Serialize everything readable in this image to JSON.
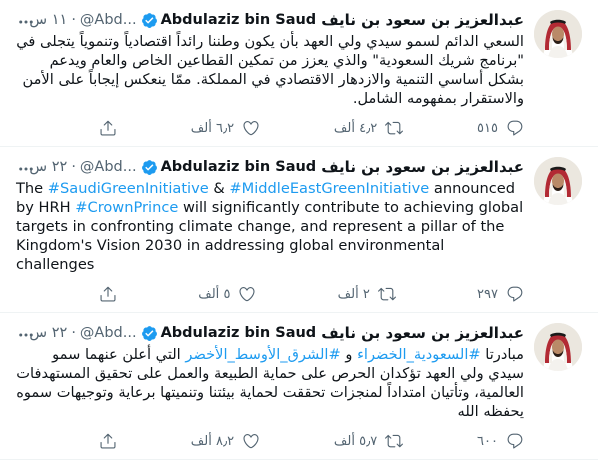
{
  "tweets": [
    {
      "name_ar": "عبدالعزيز بن سعود بن نايف",
      "name_en": "Abdulaziz bin Saud",
      "handle": "@Abd...",
      "time": "١١ س",
      "segments": [
        {
          "text": "السعي الدائم لسمو سيدي ولي العهد بأن يكون وطننا رائداً اقتصادياً وتنموياً يتجلى في \"برنامج شريك السعودية\" والذي يعزز من تمكين القطاعين الخاص والعام ويدعم بشكل أساسي التنمية والازدهار الاقتصادي في المملكة. ممّا ينعكس إيجاباً على الأمن والاستقرار بمفهومه الشامل.",
          "tag": false
        }
      ],
      "dir": "rtl",
      "replies": "٥١٥",
      "retweets": "٤٫٢ ألف",
      "likes": "٦٫٢ ألف"
    },
    {
      "name_ar": "عبدالعزيز بن سعود بن نايف",
      "name_en": "Abdulaziz bin Saud",
      "handle": "@Abd...",
      "time": "٢٢ س",
      "segments": [
        {
          "text": "The ",
          "tag": false
        },
        {
          "text": "#SaudiGreenInitiative",
          "tag": true
        },
        {
          "text": " & ",
          "tag": false
        },
        {
          "text": "#MiddleEastGreenInitiative",
          "tag": true
        },
        {
          "text": " announced by HRH ",
          "tag": false
        },
        {
          "text": "#CrownPrince",
          "tag": true
        },
        {
          "text": " will significantly contribute to achieving global targets in confronting climate change, and represent a pillar of the Kingdom's Vision 2030 in addressing global environmental challenges",
          "tag": false
        }
      ],
      "dir": "ltr",
      "replies": "٢٩٧",
      "retweets": "٢ ألف",
      "likes": "٥ ألف"
    },
    {
      "name_ar": "عبدالعزيز بن سعود بن نايف",
      "name_en": "Abdulaziz bin Saud",
      "handle": "@Abd...",
      "time": "٢٢ س",
      "segments": [
        {
          "text": "مبادرتا ",
          "tag": false
        },
        {
          "text": "#السعودية_الخضراء",
          "tag": true
        },
        {
          "text": " و ",
          "tag": false
        },
        {
          "text": "#الشرق_الأوسط_الأخضر",
          "tag": true
        },
        {
          "text": " التي أعلن عنهما سمو سيدي ولي العهد تؤكدان الحرص على حماية الطبيعة والعمل على تحقيق المستهدفات العالمية، وتأتيان امتداداً لمنجزات تحققت لحماية بيئتنا وتنميتها برعاية وتوجيهات سموه يحفظه الله",
          "tag": false
        }
      ],
      "dir": "rtl",
      "replies": "٦٠٠",
      "retweets": "٥٫٧ ألف",
      "likes": "٨٫٢ ألف"
    }
  ],
  "icons": {
    "verified": "verified-badge-icon",
    "more": "more-dots-icon",
    "reply": "reply-icon",
    "retweet": "retweet-icon",
    "like": "heart-icon",
    "share": "share-icon"
  },
  "colors": {
    "accent": "#1d9bf0",
    "muted": "#536471",
    "text": "#0f1419",
    "divider": "#eff3f4"
  }
}
